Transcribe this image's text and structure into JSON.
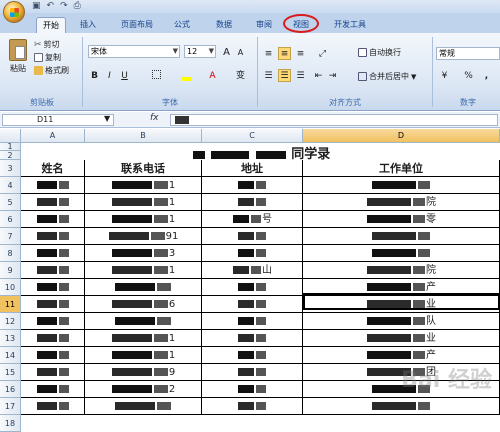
{
  "quick_access": {
    "icons": [
      "save-icon",
      "undo-icon",
      "redo-icon",
      "print-preview-icon"
    ]
  },
  "tabs": [
    "开始",
    "插入",
    "页面布局",
    "公式",
    "数据",
    "审阅",
    "视图",
    "开发工具"
  ],
  "ribbon": {
    "clipboard": {
      "paste": "粘贴",
      "cut": "剪切",
      "copy": "复制",
      "format_painter": "格式刷",
      "label": "剪贴板"
    },
    "font": {
      "name": "宋体",
      "size": "12",
      "label": "字体",
      "bold": "B",
      "italic": "I",
      "underline": "U",
      "grow": "A",
      "shrink": "A",
      "font_color": "A",
      "phonetic": "变"
    },
    "alignment": {
      "wrap": "自动换行",
      "merge": "合并后居中",
      "label": "对齐方式"
    },
    "number": {
      "format": "常规",
      "percent": "%",
      "comma": ",",
      "label": "数字"
    }
  },
  "formula_bar": {
    "name_box": "D11",
    "fx": "fx",
    "content": ""
  },
  "grid": {
    "columns": [
      "A",
      "B",
      "C",
      "D"
    ],
    "rows": [
      "1",
      "2",
      "3",
      "4",
      "5",
      "6",
      "7",
      "8",
      "9",
      "10",
      "11",
      "12",
      "13",
      "14",
      "15",
      "16",
      "17",
      "18"
    ],
    "title": "同学录",
    "headers": [
      "姓名",
      "联系电话",
      "地址",
      "工作单位"
    ],
    "records": [
      [
        "",
        "1",
        "",
        ""
      ],
      [
        "",
        "1",
        "",
        "院"
      ],
      [
        "",
        "1",
        "号",
        "零"
      ],
      [
        "",
        "91",
        "",
        ""
      ],
      [
        "",
        "3",
        "",
        ""
      ],
      [
        "",
        "1",
        "山",
        "院"
      ],
      [
        "",
        "",
        "",
        "产"
      ],
      [
        "",
        "6",
        "",
        "业"
      ],
      [
        "",
        "",
        "",
        "队"
      ],
      [
        "",
        "1",
        "",
        "业"
      ],
      [
        "",
        "1",
        "",
        "产"
      ],
      [
        "",
        "9",
        "",
        "团"
      ],
      [
        "",
        "2",
        "",
        ""
      ],
      [
        "",
        "",
        "",
        ""
      ]
    ],
    "selected_cell": "D11"
  },
  "watermark": "Bai 经验"
}
